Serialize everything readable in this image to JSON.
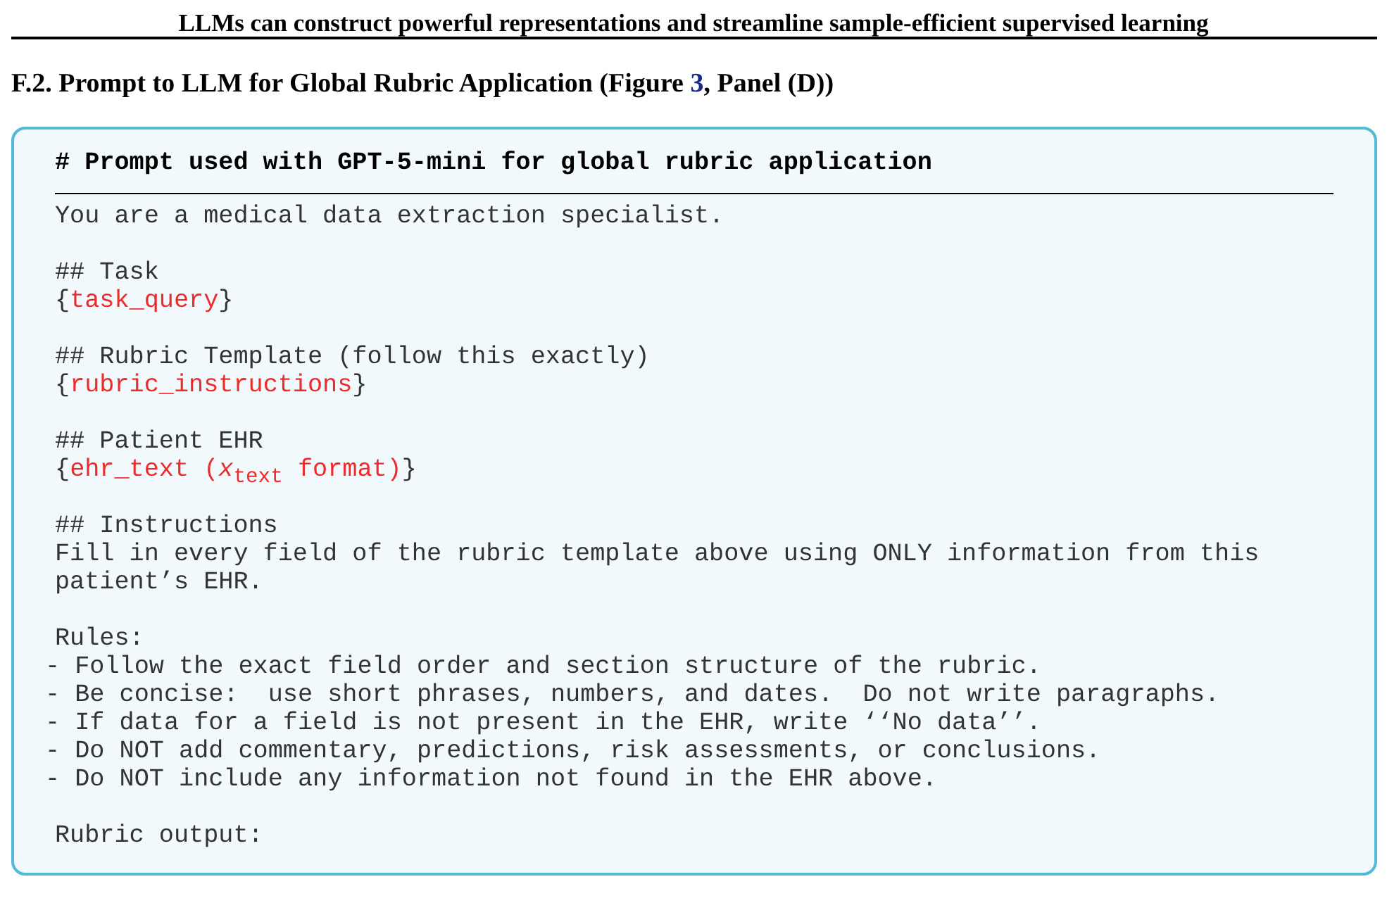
{
  "running_header": "LLMs can construct powerful representations and streamline sample-efficient supervised learning",
  "section_heading": {
    "before": "F.2. Prompt to LLM for Global Rubric Application (Figure ",
    "link": "3",
    "after": ", Panel (D))"
  },
  "prompt_box": {
    "title": "# Prompt used with GPT-5-mini for global rubric application",
    "lines": [
      {
        "kind": "text",
        "text": "You are a medical data extraction specialist."
      },
      {
        "kind": "blank"
      },
      {
        "kind": "text",
        "text": "## Task"
      },
      {
        "kind": "placeholder",
        "open": "{",
        "name": "task_query",
        "close": "}"
      },
      {
        "kind": "blank"
      },
      {
        "kind": "text",
        "text": "## Rubric Template (follow this exactly)"
      },
      {
        "kind": "placeholder",
        "open": "{",
        "name": "rubric_instructions",
        "close": "}"
      },
      {
        "kind": "blank"
      },
      {
        "kind": "text",
        "text": "## Patient EHR"
      },
      {
        "kind": "placeholder",
        "open": "{",
        "name": "ehr_text (*x*$_{text}$ format)",
        "close": "}"
      },
      {
        "kind": "blank"
      },
      {
        "kind": "text",
        "text": "## Instructions"
      },
      {
        "kind": "text",
        "text": "Fill in every field of the rubric template above using ONLY information from this"
      },
      {
        "kind": "text",
        "text": "patient’s EHR."
      },
      {
        "kind": "blank"
      },
      {
        "kind": "text",
        "text": "Rules:"
      },
      {
        "kind": "bullet",
        "text": "- Follow the exact field order and section structure of the rubric."
      },
      {
        "kind": "bullet",
        "text": "- Be concise:  use short phrases, numbers, and dates.  Do not write paragraphs."
      },
      {
        "kind": "bullet",
        "text": "- If data for a field is not present in the EHR, write ‘‘No data’’."
      },
      {
        "kind": "bullet",
        "text": "- Do NOT add commentary, predictions, risk assessments, or conclusions."
      },
      {
        "kind": "bullet",
        "text": "- Do NOT include any information not found in the EHR above."
      },
      {
        "kind": "blank"
      },
      {
        "kind": "text",
        "text": "Rubric output:"
      }
    ]
  }
}
